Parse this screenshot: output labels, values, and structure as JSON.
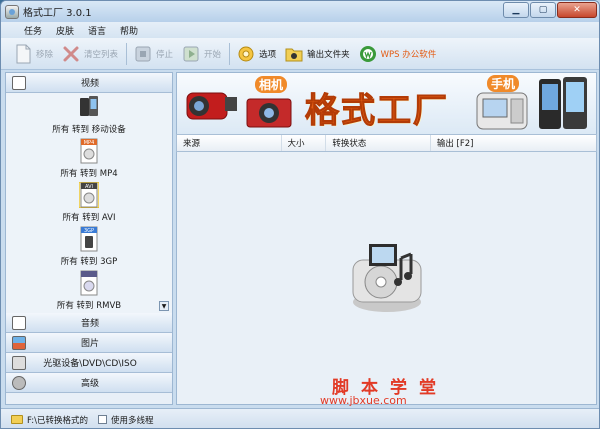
{
  "window": {
    "title": "格式工厂 3.0.1"
  },
  "menu": [
    "任务",
    "皮肤",
    "语言",
    "帮助"
  ],
  "toolbar": {
    "remove": "移除",
    "clear_list": "清空列表",
    "stop": "停止",
    "start": "开始",
    "options": "选项",
    "output_folder": "输出文件夹",
    "wps": "WPS 办公软件"
  },
  "sidebar": {
    "video_header": "视频",
    "video_items": [
      "所有 转到 移动设备",
      "所有 转到 MP4",
      "所有 转到 AVI",
      "所有 转到 3GP",
      "所有 转到 RMVB"
    ],
    "video_thumb_labels": [
      "",
      "MP4",
      "AVI",
      "3GP",
      ""
    ],
    "audio_header": "音频",
    "picture_header": "图片",
    "rom_header": "光驱设备\\DVD\\CD\\ISO",
    "advanced_header": "高级"
  },
  "banner": {
    "title": "格式工厂",
    "camera_badge": "相机",
    "phone_badge": "手机"
  },
  "table": {
    "columns": [
      "来源",
      "大小",
      "转换状态",
      "输出 [F2]"
    ]
  },
  "status": {
    "output_path": "F:\\已转换格式的",
    "multithread": "使用多线程"
  },
  "watermark": {
    "line1": "脚本学堂",
    "line2": "www.jbxue.com"
  },
  "colors": {
    "banner_text": "#e35b13",
    "watermark": "#e23a26",
    "accent": "#f08a2a"
  }
}
